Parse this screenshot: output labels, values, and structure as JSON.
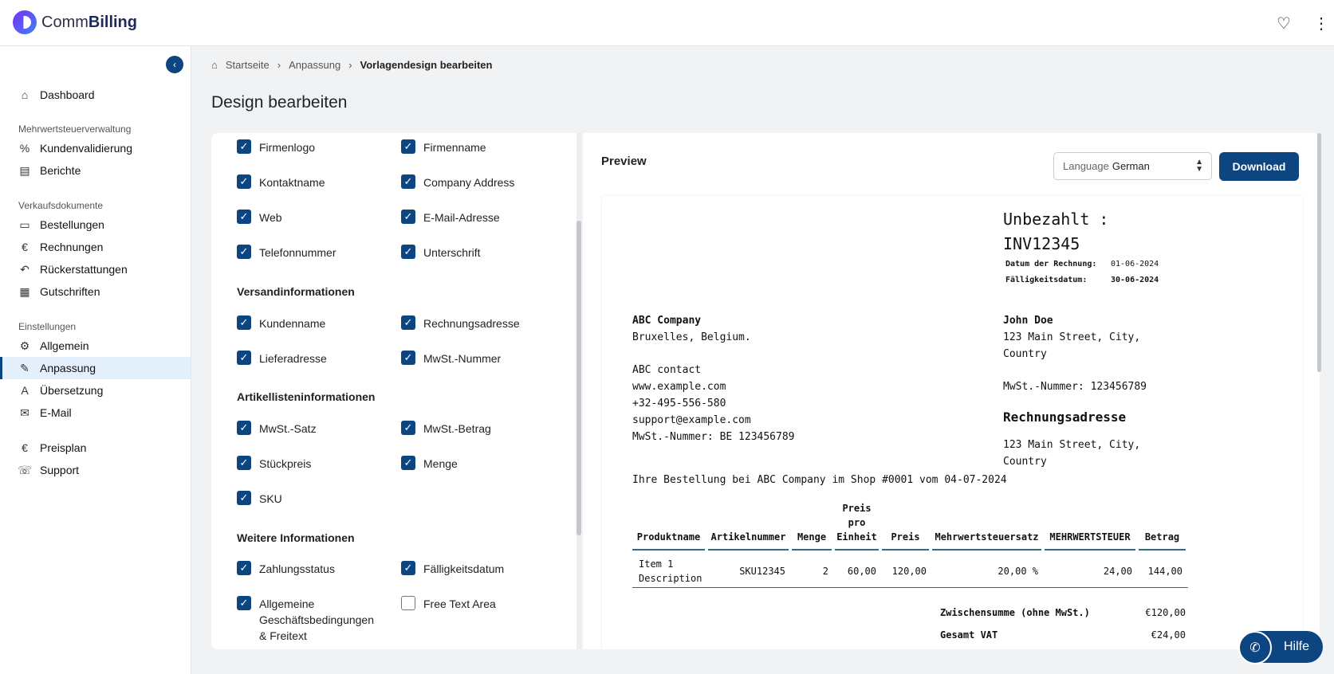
{
  "app": {
    "brand_light": "Comm",
    "brand_bold": "Billing"
  },
  "topbar": {
    "favorite_icon": "♡",
    "more_icon": "⋮"
  },
  "sidebar": {
    "collapse_icon": "‹",
    "items": [
      {
        "label": "Dashboard",
        "icon": "⌂"
      },
      {
        "section": "Mehrwertsteuerverwaltung"
      },
      {
        "label": "Kundenvalidierung",
        "icon": "%"
      },
      {
        "label": "Berichte",
        "icon": "▤"
      },
      {
        "section": "Verkaufsdokumente"
      },
      {
        "label": "Bestellungen",
        "icon": "▭"
      },
      {
        "label": "Rechnungen",
        "icon": "€"
      },
      {
        "label": "Rückerstattungen",
        "icon": "↶"
      },
      {
        "label": "Gutschriften",
        "icon": "▦"
      },
      {
        "section": "Einstellungen"
      },
      {
        "label": "Allgemein",
        "icon": "⚙"
      },
      {
        "label": "Anpassung",
        "icon": "✎"
      },
      {
        "label": "Übersetzung",
        "icon": "A"
      },
      {
        "label": "E-Mail",
        "icon": "✉"
      },
      {
        "label": "Preisplan",
        "icon": "€"
      },
      {
        "label": "Support",
        "icon": "☏"
      }
    ]
  },
  "breadcrumb": {
    "home_icon": "⌂",
    "home": "Startseite",
    "sep": "›",
    "level2": "Anpassung",
    "current": "Vorlagendesign bearbeiten"
  },
  "page": {
    "title": "Design bearbeiten"
  },
  "options": {
    "company": [
      "Firmenlogo",
      "Firmenname",
      "Kontaktname",
      "Company Address",
      "Web",
      "E-Mail-Adresse",
      "Telefonnummer",
      "Unterschrift"
    ],
    "shipping_title": "Versandinformationen",
    "shipping": [
      "Kundenname",
      "Rechnungsadresse",
      "Lieferadresse",
      "MwSt.-Nummer"
    ],
    "items_title": "Artikellisteninformationen",
    "items": [
      "MwSt.-Satz",
      "MwSt.-Betrag",
      "Stückpreis",
      "Menge",
      "SKU"
    ],
    "more_title": "Weitere Informationen",
    "more": [
      "Zahlungsstatus",
      "Fälligkeitsdatum",
      "Allgemeine Geschäftsbedingungen & Freitext",
      "Free Text Area"
    ],
    "free_text_checked": false
  },
  "preview": {
    "title": "Preview",
    "language_label": "Language",
    "language_value": "German",
    "download": "Download",
    "status_title": "Unbezahlt :",
    "invoice_number": "INV12345",
    "date_label": "Datum der Rechnung:",
    "date_value": "01-06-2024",
    "due_label": "Fälligkeitsdatum:",
    "due_value": "30-06-2024",
    "seller": {
      "name": "ABC Company",
      "city": "Bruxelles, Belgium.",
      "contact": "ABC contact",
      "web": "www.example.com",
      "phone": "+32-495-556-580",
      "email": "support@example.com",
      "vat": "MwSt.-Nummer: BE 123456789"
    },
    "buyer": {
      "name": "John Doe",
      "addr1": "123 Main Street, City,",
      "addr2": "Country",
      "vat": "MwSt.-Nummer: 123456789",
      "billing_title": "Rechnungsadresse",
      "bill1": "123 Main Street, City,",
      "bill2": "Country"
    },
    "order_line": "Ihre Bestellung bei ABC Company im Shop #0001 vom 04-07-2024",
    "table": {
      "headers": [
        "Produktname",
        "Artikelnummer",
        "Menge",
        "Preis pro Einheit",
        "Preis",
        "Mehrwertsteuersatz",
        "MEHRWERTSTEUER",
        "Betrag"
      ],
      "row": [
        "Item 1 Description",
        "SKU12345",
        "2",
        "60,00",
        "120,00",
        "20,00 %",
        "24,00",
        "144,00"
      ]
    },
    "subtotal_label": "Zwischensumme (ohne MwSt.)",
    "subtotal_value": "€120,00",
    "vat_total_label": "Gesamt VAT",
    "vat_total_value": "€24,00"
  },
  "help": {
    "label": "Hilfe",
    "icon": "✆"
  }
}
